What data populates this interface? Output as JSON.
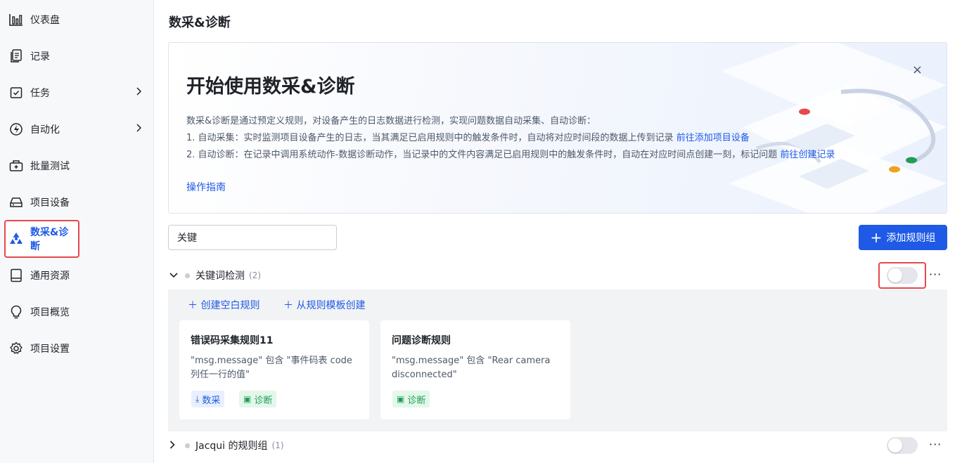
{
  "sidebar": {
    "items": [
      {
        "label": "仪表盘",
        "icon": "bar-chart-icon"
      },
      {
        "label": "记录",
        "icon": "document-icon"
      },
      {
        "label": "任务",
        "icon": "task-icon"
      },
      {
        "label": "自动化",
        "icon": "automation-icon"
      },
      {
        "label": "批量测试",
        "icon": "batch-test-icon"
      },
      {
        "label": "项目设备",
        "icon": "device-icon"
      },
      {
        "label": "数采&诊断",
        "icon": "radiation-icon"
      },
      {
        "label": "通用资源",
        "icon": "book-icon"
      },
      {
        "label": "项目概览",
        "icon": "bulb-icon"
      },
      {
        "label": "项目设置",
        "icon": "gear-icon"
      }
    ]
  },
  "page": {
    "title": "数采&诊断"
  },
  "banner": {
    "title": "开始使用数采&诊断",
    "desc1": "数采&诊断是通过预定义规则，对设备产生的日志数据进行检测，实现问题数据自动采集、自动诊断：",
    "desc2": "1. 自动采集：实时监测项目设备产生的日志，当其满足已启用规则中的触发条件时，自动将对应时间段的数据上传到记录",
    "desc2_link": "前往添加项目设备",
    "desc3": "2. 自动诊断：在记录中调用系统动作-数据诊断动作，当记录中的文件内容满足已启用规则中的触发条件时，自动在对应时间点创建一刻，标记问题",
    "desc3_link": "前往创建记录",
    "guide": "操作指南",
    "close": "×"
  },
  "toolbar": {
    "search_value": "关键",
    "add_group": "添加规则组"
  },
  "groups": [
    {
      "name": "关键词检测",
      "count": "(2)",
      "enabled": false,
      "create_blank": "创建空白规则",
      "create_template": "从规则模板创建",
      "rules": [
        {
          "title": "错误码采集规则11",
          "desc": "\"msg.message\" 包含 \"事件码表 code 列任一行的值\"",
          "tags": [
            "数采",
            "诊断"
          ]
        },
        {
          "title": "问题诊断规则",
          "desc": "\"msg.message\" 包含 \"Rear camera disconnected\"",
          "tags": [
            "诊断"
          ]
        }
      ]
    },
    {
      "name": "Jacqui 的规则组",
      "count": "(1)",
      "enabled": false
    }
  ],
  "colors": {
    "accent": "#1f5ae6",
    "highlight": "#e5484d",
    "diagnose": "#1f9d55"
  }
}
